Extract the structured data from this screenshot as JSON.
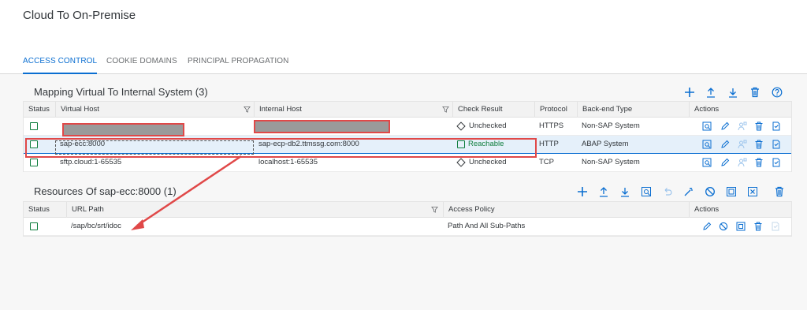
{
  "page": {
    "title": "Cloud To On-Premise"
  },
  "tabs": [
    {
      "label": "ACCESS CONTROL",
      "active": true
    },
    {
      "label": "COOKIE DOMAINS",
      "active": false
    },
    {
      "label": "PRINCIPAL PROPAGATION",
      "active": false
    }
  ],
  "mapping": {
    "title": "Mapping Virtual To Internal System",
    "count": "(3)",
    "toolbar_icons": [
      "add-icon",
      "upload-icon",
      "download-icon",
      "delete-icon",
      "help-icon"
    ],
    "columns": [
      "Status",
      "Virtual Host",
      "Internal Host",
      "Check Result",
      "Protocol",
      "Back-end Type",
      "Actions"
    ],
    "rows": [
      {
        "virtual_host": "",
        "internal_host": "",
        "check_result": "Unchecked",
        "protocol": "HTTPS",
        "backend_type": "Non-SAP System",
        "redacted": true
      },
      {
        "virtual_host": "sap-ecc:8000",
        "internal_host": "sap-ecp-db2.ttmssg.com:8000",
        "check_result": "Reachable",
        "protocol": "HTTP",
        "backend_type": "ABAP System",
        "selected": true
      },
      {
        "virtual_host": "sftp.cloud:1-65535",
        "internal_host": "localhost:1-65535",
        "check_result": "Unchecked",
        "protocol": "TCP",
        "backend_type": "Non-SAP System"
      }
    ],
    "row_action_icons": [
      "view-icon",
      "edit-icon",
      "principal-icon",
      "delete-icon",
      "check-icon"
    ]
  },
  "resources": {
    "title": "Resources Of sap-ecc:8000",
    "count": "(1)",
    "toolbar_icons": [
      "add-icon",
      "upload-icon",
      "download-icon",
      "view-icon",
      "undo-icon",
      "wand-icon",
      "block-icon",
      "copy-icon",
      "clear-icon",
      "delete-icon"
    ],
    "columns": [
      "Status",
      "URL Path",
      "Access Policy",
      "Actions"
    ],
    "rows": [
      {
        "url_path": "/sap/bc/srt/idoc",
        "access_policy": "Path And All Sub-Paths"
      }
    ],
    "row_action_icons": [
      "edit-icon",
      "block-icon",
      "copy-icon",
      "delete-icon",
      "check-icon"
    ]
  },
  "colors": {
    "accent": "#0a6ed1",
    "positive": "#107e3e",
    "annotation": "#e04848",
    "icon": "#0a6ed1"
  }
}
